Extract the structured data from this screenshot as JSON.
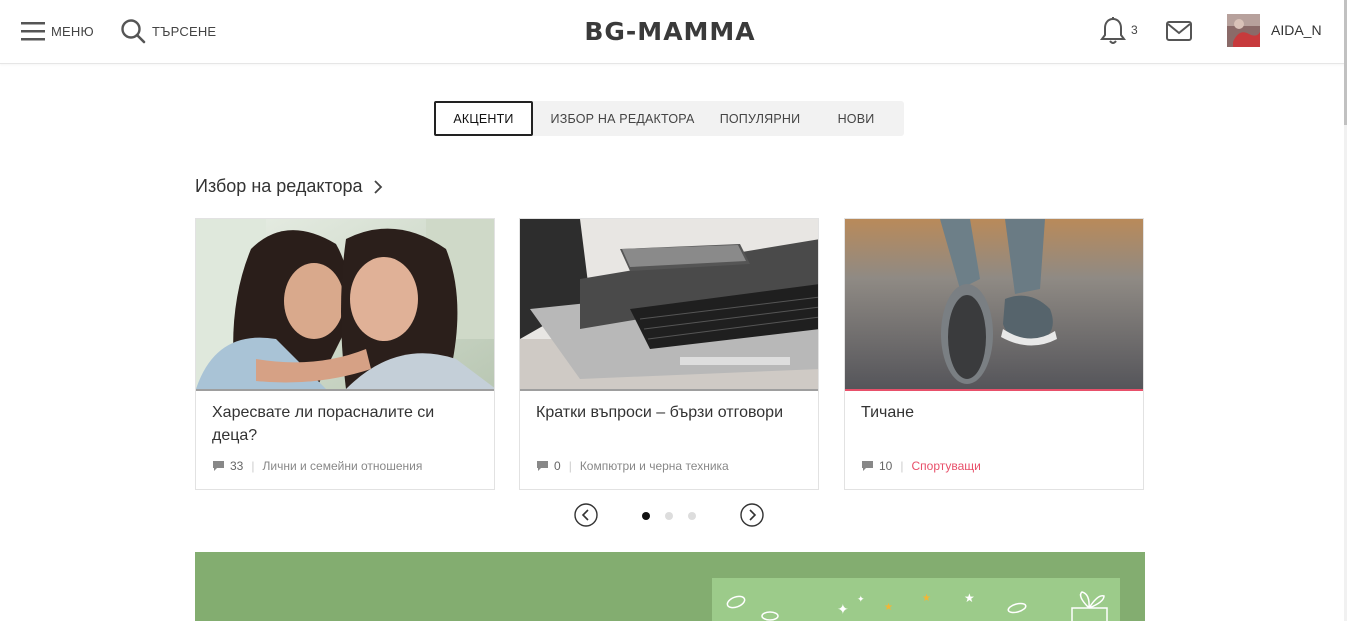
{
  "header": {
    "menu_label": "МЕНЮ",
    "search_label": "ТЪРСЕНЕ",
    "logo_text": "BG-MAMMA",
    "notifications_count": "3",
    "username": "AIDA_N"
  },
  "tabs": [
    {
      "label": "АКЦЕНТИ",
      "active": true
    },
    {
      "label": "ИЗБОР НА РЕДАКТОРА",
      "active": false
    },
    {
      "label": "ПОПУЛЯРНИ",
      "active": false
    },
    {
      "label": "НОВИ",
      "active": false
    }
  ],
  "section": {
    "title": "Избор на редактора"
  },
  "cards": [
    {
      "title": "Харесвате ли порасналите си деца?",
      "comments": "33",
      "category": "Лични и семейни отношения",
      "image": "mother-daughter-hug"
    },
    {
      "title": "Кратки въпроси – бързи отговори",
      "comments": "0",
      "category": "Компютри и черна техника",
      "image": "laptop-phone"
    },
    {
      "title": "Тичане",
      "comments": "10",
      "category": "Спортуващи",
      "image": "running-shoes"
    }
  ],
  "carousel": {
    "pages": 3,
    "active_page": 1
  },
  "colors": {
    "accent_pink": "#e8506a",
    "banner_green": "#83ad70",
    "banner_light_green": "#9ccb8a"
  }
}
